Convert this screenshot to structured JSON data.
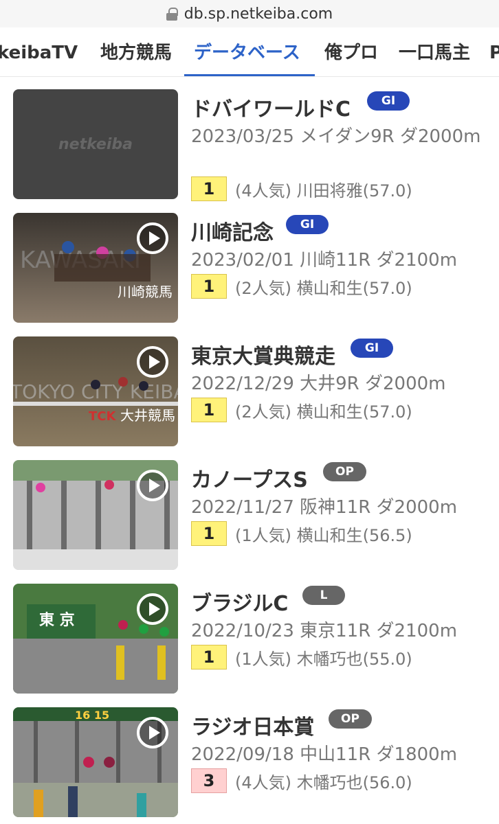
{
  "browser": {
    "url": "db.sp.netkeiba.com"
  },
  "tabs": [
    {
      "label": "keibaTV",
      "active": false
    },
    {
      "label": "地方競馬",
      "active": false
    },
    {
      "label": "データベース",
      "active": true
    },
    {
      "label": "俺プロ",
      "active": false
    },
    {
      "label": "一口馬主",
      "active": false
    },
    {
      "label": "P",
      "active": false
    }
  ],
  "races": [
    {
      "name": "ドバイワールドC",
      "grade": "GI",
      "grade_color": "#2747b8",
      "meta": "2023/03/25 メイダン9R ダ2000m",
      "rank": "1",
      "rank_color": "#fff27a",
      "detail": "(4人気) 川田将雅(57.0)",
      "thumb_text": "netkeiba",
      "has_play": false
    },
    {
      "name": "川崎記念",
      "grade": "GI",
      "grade_color": "#2747b8",
      "meta": "2023/02/01 川崎11R ダ2100m",
      "rank": "1",
      "rank_color": "#fff27a",
      "detail": "(2人気) 横山和生(57.0)",
      "thumb_text": "川崎競馬",
      "thumb_caption": "KAWASAKI",
      "has_play": true
    },
    {
      "name": "東京大賞典競走",
      "grade": "GI",
      "grade_color": "#2747b8",
      "meta": "2022/12/29 大井9R ダ2000m",
      "rank": "1",
      "rank_color": "#fff27a",
      "detail": "(2人気) 横山和生(57.0)",
      "thumb_text": "大井競馬",
      "thumb_caption": "TOKYO CITY KEIBA",
      "has_play": true
    },
    {
      "name": "カノープスS",
      "grade": "OP",
      "grade_color": "#666666",
      "meta": "2022/11/27 阪神11R ダ2000m",
      "rank": "1",
      "rank_color": "#fff27a",
      "detail": "(1人気) 横山和生(56.5)",
      "thumb_text": "",
      "has_play": true
    },
    {
      "name": "ブラジルC",
      "grade": "L",
      "grade_color": "#666666",
      "meta": "2022/10/23 東京11R ダ2100m",
      "rank": "1",
      "rank_color": "#fff27a",
      "detail": "(1人気) 木幡巧也(55.0)",
      "thumb_text": "東 京",
      "has_play": true
    },
    {
      "name": "ラジオ日本賞",
      "grade": "OP",
      "grade_color": "#666666",
      "meta": "2022/09/18 中山11R ダ1800m",
      "rank": "3",
      "rank_color": "#ffd0d0",
      "detail": "(4人気) 木幡巧也(56.0)",
      "thumb_text": "16 15",
      "has_play": true
    }
  ]
}
